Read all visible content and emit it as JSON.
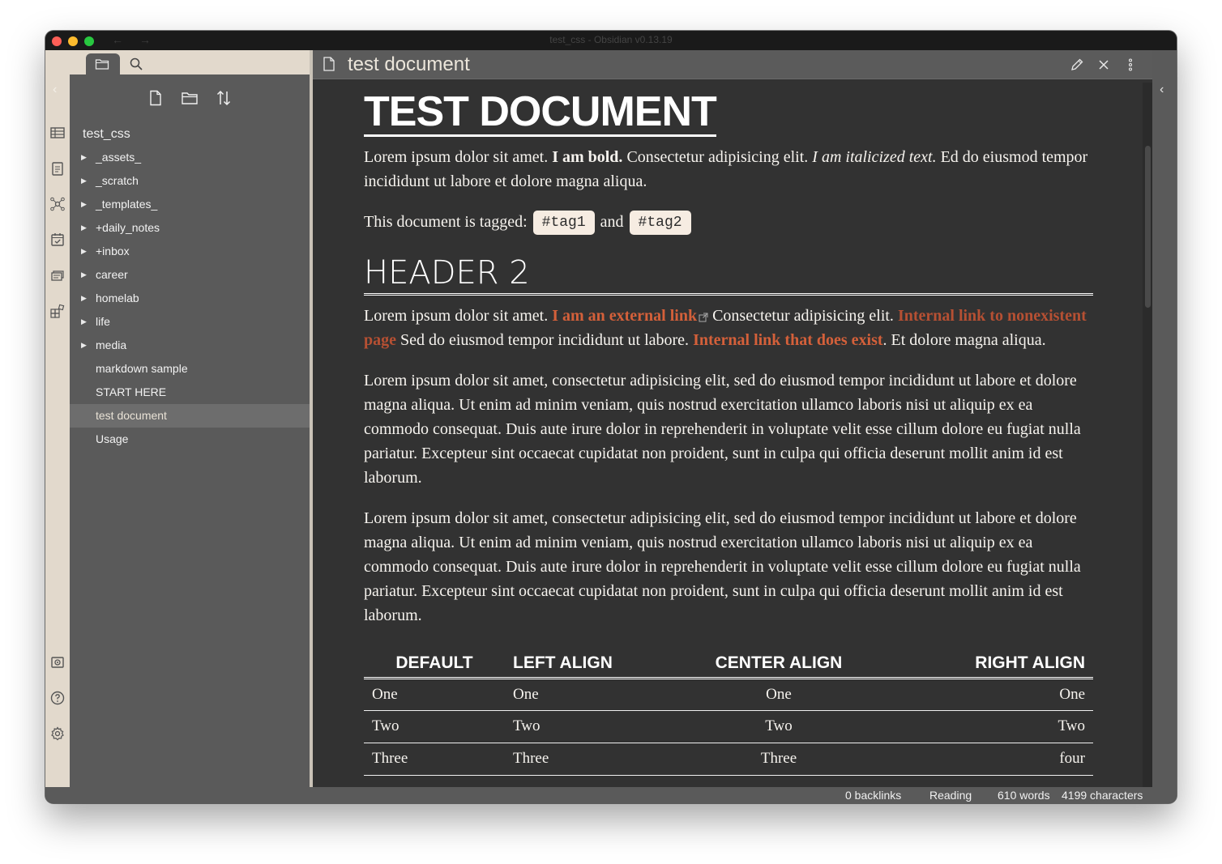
{
  "window": {
    "title": "test_css - Obsidian v0.13.19"
  },
  "sidebar": {
    "vault_name": "test_css",
    "items": [
      {
        "label": "_assets_",
        "folder": true
      },
      {
        "label": "_scratch",
        "folder": true
      },
      {
        "label": "_templates_",
        "folder": true
      },
      {
        "label": "+daily_notes",
        "folder": true
      },
      {
        "label": "+inbox",
        "folder": true
      },
      {
        "label": "career",
        "folder": true
      },
      {
        "label": "homelab",
        "folder": true
      },
      {
        "label": "life",
        "folder": true
      },
      {
        "label": "media",
        "folder": true
      },
      {
        "label": "markdown sample",
        "folder": false
      },
      {
        "label": "START HERE",
        "folder": false
      },
      {
        "label": "test document",
        "folder": false,
        "active": true
      },
      {
        "label": "Usage",
        "folder": false
      }
    ]
  },
  "view": {
    "title": "test document"
  },
  "doc": {
    "h1": "TEST DOCUMENT",
    "p1": {
      "a": "Lorem ipsum dolor sit amet. ",
      "bold": "I am bold.",
      "b": " Consectetur adipisicing elit. ",
      "italic": "I am italicized text.",
      "c": " Ed do eiusmod tempor incididunt ut labore et dolore magna aliqua."
    },
    "tags": {
      "prefix": "This document is tagged: ",
      "tag1": "#tag1",
      "and": " and ",
      "tag2": "#tag2"
    },
    "h2": "HEADER 2",
    "p2": {
      "a": "Lorem ipsum dolor sit amet. ",
      "ext_link": "I am an external link",
      "b": " Consectetur adipisicing elit. ",
      "internal_missing": "Internal link to nonexistent page",
      "c": " Sed do eiusmod tempor incididunt ut labore. ",
      "internal_exists": "Internal link that does exist",
      "d": ". Et dolore magna aliqua."
    },
    "p3": "Lorem ipsum dolor sit amet, consectetur adipisicing elit, sed do eiusmod tempor incididunt ut labore et dolore magna aliqua. Ut enim ad minim veniam, quis nostrud exercitation ullamco laboris nisi ut aliquip ex ea commodo consequat. Duis aute irure dolor in reprehenderit in voluptate velit esse cillum dolore eu fugiat nulla pariatur. Excepteur sint occaecat cupidatat non proident, sunt in culpa qui officia deserunt mollit anim id est laborum.",
    "p4": "Lorem ipsum dolor sit amet, consectetur adipisicing elit, sed do eiusmod tempor incididunt ut labore et dolore magna aliqua. Ut enim ad minim veniam, quis nostrud exercitation ullamco laboris nisi ut aliquip ex ea commodo consequat. Duis aute irure dolor in reprehenderit in voluptate velit esse cillum dolore eu fugiat nulla pariatur. Excepteur sint occaecat cupidatat non proident, sunt in culpa qui officia deserunt mollit anim id est laborum.",
    "table": {
      "headers": [
        "DEFAULT",
        "LEFT ALIGN",
        "CENTER ALIGN",
        "RIGHT ALIGN"
      ],
      "rows": [
        [
          "One",
          "One",
          "One",
          "One"
        ],
        [
          "Two",
          "Two",
          "Two",
          "Two"
        ],
        [
          "Three",
          "Three",
          "Three",
          "four"
        ]
      ]
    }
  },
  "status": {
    "backlinks": "0 backlinks",
    "mode": "Reading",
    "words": "610 words",
    "characters": "4199 characters"
  },
  "colors": {
    "accent_link": "#d4603a",
    "sidebar_bg": "#5a5a5a",
    "ribbon_bg": "#e2d9cc",
    "editor_bg": "#323232",
    "tag_bg": "#f6ece2"
  }
}
